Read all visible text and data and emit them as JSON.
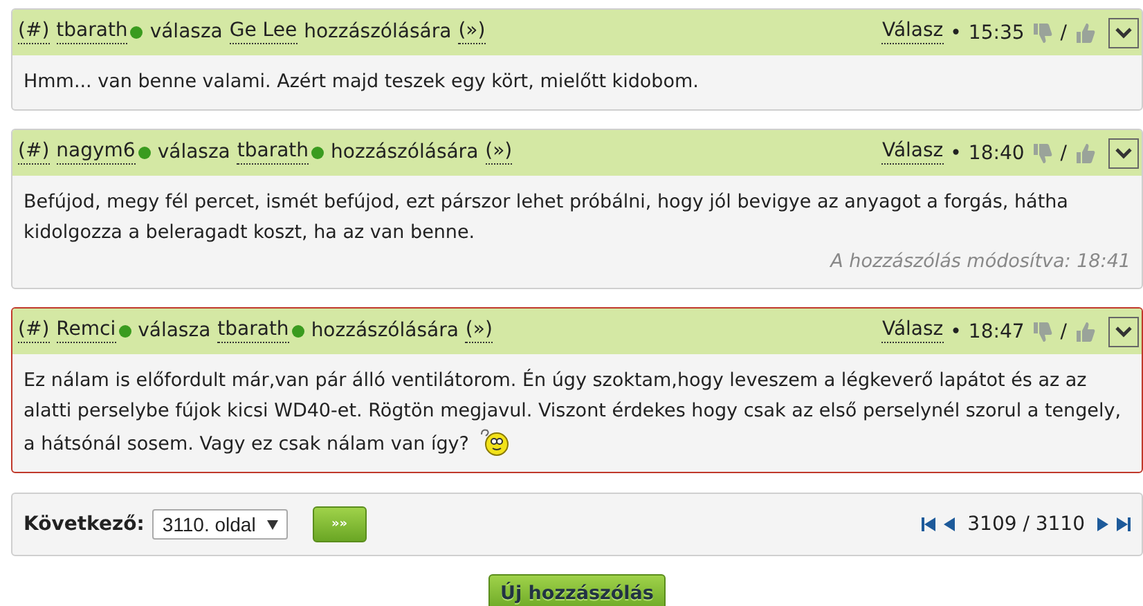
{
  "posts": [
    {
      "anchor": "(#)",
      "author": {
        "name": "tbarath",
        "online": true
      },
      "verb": "válasza",
      "target": {
        "name": "Ge Lee",
        "online": false
      },
      "suffix": "hozzászólására",
      "jump": "(»)",
      "reply": "Válasz",
      "separator": "•",
      "time": "15:35",
      "slash": "/",
      "highlighted": false,
      "body": "Hmm... van benne valami. Azért majd teszek egy kört, mielőtt kidobom.",
      "emoticon": false
    },
    {
      "anchor": "(#)",
      "author": {
        "name": "nagym6",
        "online": true
      },
      "verb": "válasza",
      "target": {
        "name": "tbarath",
        "online": true
      },
      "suffix": "hozzászólására",
      "jump": "(»)",
      "reply": "Válasz",
      "separator": "•",
      "time": "18:40",
      "slash": "/",
      "highlighted": false,
      "body": "Befújod, megy fél percet, ismét befújod, ezt párszor lehet próbálni, hogy jól bevigye az anyagot a forgás, hátha kidolgozza a beleragadt koszt, ha az van benne.",
      "edited": "A hozzászólás módosítva: 18:41",
      "emoticon": false
    },
    {
      "anchor": "(#)",
      "author": {
        "name": "Remci",
        "online": true
      },
      "verb": "válasza",
      "target": {
        "name": "tbarath",
        "online": true
      },
      "suffix": "hozzászólására",
      "jump": "(»)",
      "reply": "Válasz",
      "separator": "•",
      "time": "18:47",
      "slash": "/",
      "highlighted": true,
      "body": "Ez nálam is előfordult már,van pár álló ventilátorom. Én úgy szoktam,hogy leveszem a légkeverő lapátot és az az alatti perselybe fújok kicsi WD40-et. Rögtön megjavul. Viszont érdekes hogy csak az első perselynél szorul a tengely, a hátsónál sosem. Vagy ez csak nálam van így?",
      "emoticon": true
    }
  ],
  "pager": {
    "label": "Következő:",
    "page_select": "3110. oldal",
    "go": "»»",
    "position": "3109 / 3110"
  },
  "new_post": "Új hozzászólás"
}
